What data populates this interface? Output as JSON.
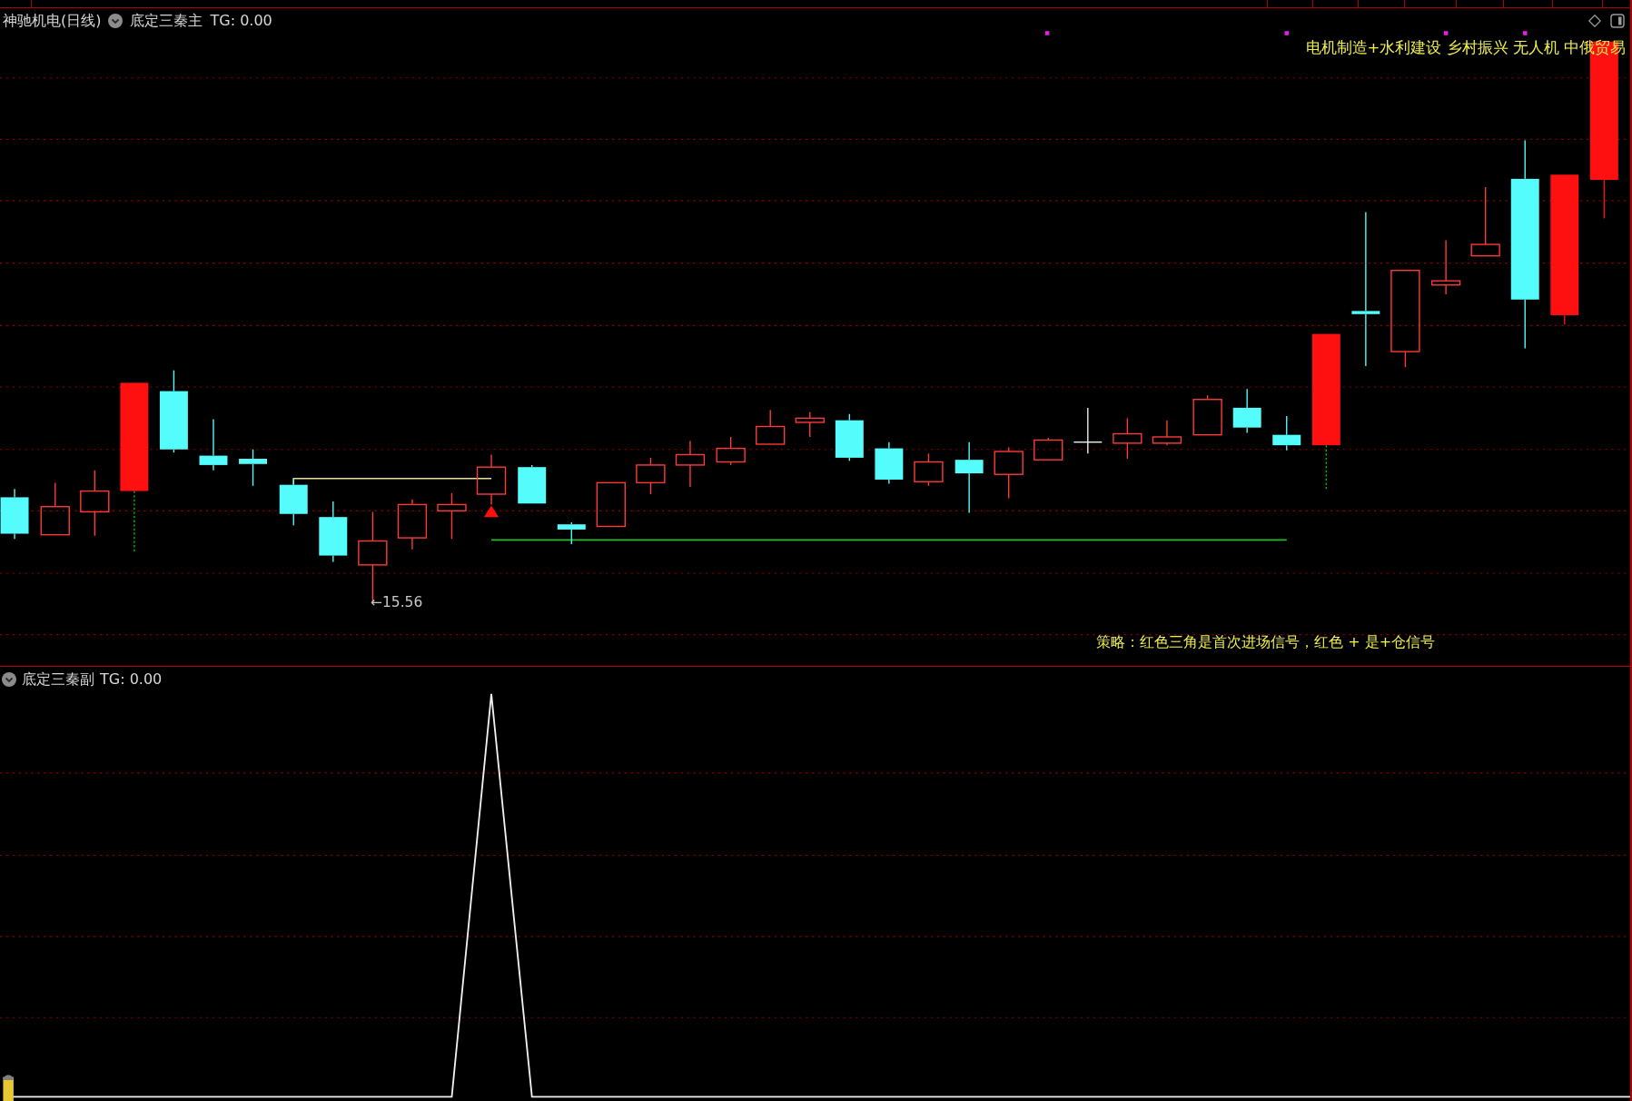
{
  "main_panel": {
    "title": "神驰机电(日线)",
    "indicator": "底定三秦主",
    "tg": "TG: 0.00",
    "concept_tags": "电机制造+水利建设 乡村振兴 无人机 中俄贸易",
    "low_label": "←15.56",
    "strategy_note": "策略：红色三角是首次进场信号，红色 + 是+仓信号"
  },
  "sub_panel": {
    "indicator": "底定三秦副",
    "tg": "TG: 0.00"
  }
}
